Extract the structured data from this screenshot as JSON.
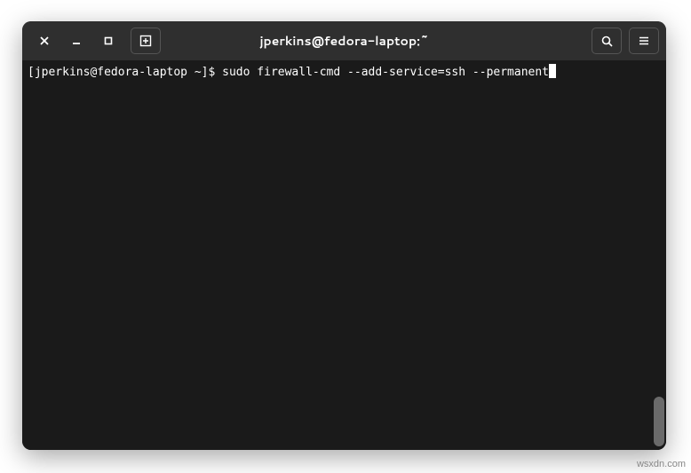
{
  "window": {
    "title": "jperkins@fedora-laptop:~"
  },
  "terminal": {
    "prompt": "[jperkins@fedora-laptop ~]$ ",
    "command": "sudo firewall-cmd --add-service=ssh --permanent"
  },
  "watermark": "wsxdn.com"
}
